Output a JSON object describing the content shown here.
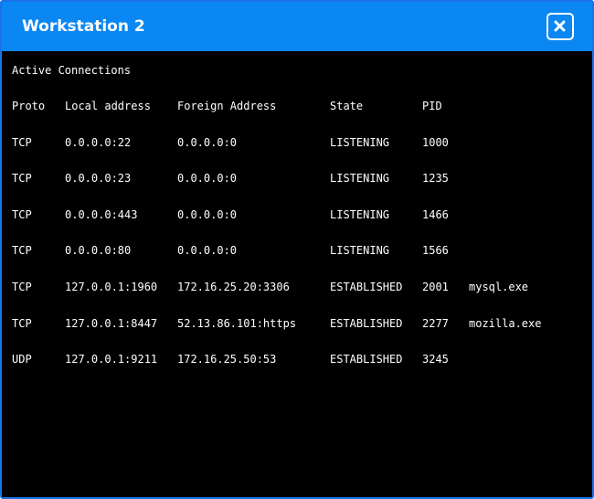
{
  "window": {
    "title": "Workstation 2",
    "close_icon": "close-x-icon",
    "accent_color": "#0a87f2"
  },
  "terminal": {
    "heading": "Active Connections",
    "headers": [
      "Proto",
      "Local address",
      "Foreign Address",
      "State",
      "PID"
    ],
    "rows": [
      [
        "TCP",
        "0.0.0.0:22",
        "0.0.0.0:0",
        "LISTENING",
        "1000",
        ""
      ],
      [
        "TCP",
        "0.0.0.0:23",
        "0.0.0.0:0",
        "LISTENING",
        "1235",
        ""
      ],
      [
        "TCP",
        "0.0.0.0:443",
        "0.0.0.0:0",
        "LISTENING",
        "1466",
        ""
      ],
      [
        "TCP",
        "0.0.0.0:80",
        "0.0.0.0:0",
        "LISTENING",
        "1566",
        ""
      ],
      [
        "TCP",
        "127.0.0.1:1960",
        "172.16.25.20:3306",
        "ESTABLISHED",
        "2001",
        "mysql.exe"
      ],
      [
        "TCP",
        "127.0.0.1:8447",
        "52.13.86.101:https",
        "ESTABLISHED",
        "2277",
        "mozilla.exe"
      ],
      [
        "UDP",
        "127.0.0.1:9211",
        "172.16.25.50:53",
        "ESTABLISHED",
        "3245",
        ""
      ]
    ]
  }
}
